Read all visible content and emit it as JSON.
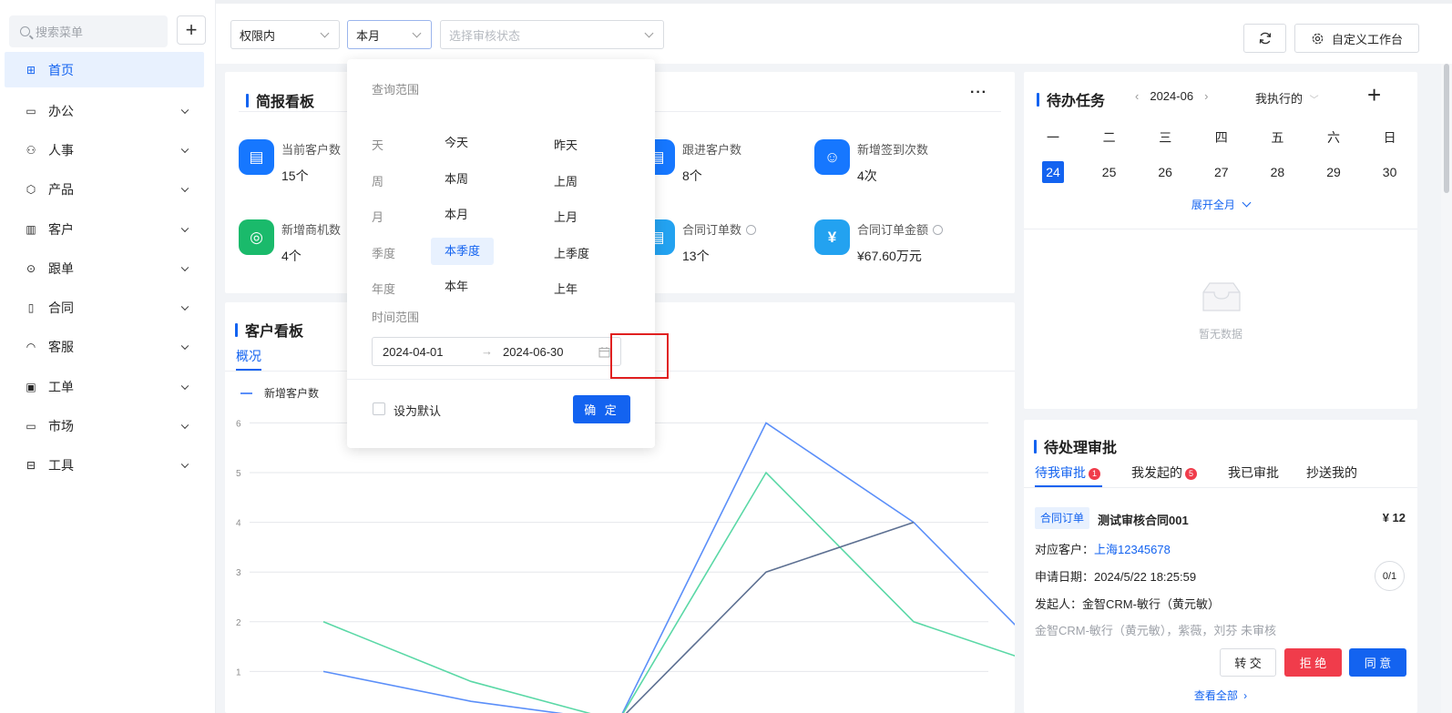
{
  "sidebar": {
    "search_placeholder": "搜索菜单",
    "add_label": "+",
    "items": [
      {
        "label": "首页",
        "icon": "home-icon",
        "glyph": "⊞"
      },
      {
        "label": "办公",
        "icon": "office-icon",
        "glyph": "▭"
      },
      {
        "label": "人事",
        "icon": "hr-icon",
        "glyph": "⚇"
      },
      {
        "label": "产品",
        "icon": "product-icon",
        "glyph": "⬡"
      },
      {
        "label": "客户",
        "icon": "customer-icon",
        "glyph": "▥"
      },
      {
        "label": "跟单",
        "icon": "followup-icon",
        "glyph": "⊙"
      },
      {
        "label": "合同",
        "icon": "contract-icon",
        "glyph": "▯"
      },
      {
        "label": "客服",
        "icon": "service-icon",
        "glyph": "◠"
      },
      {
        "label": "工单",
        "icon": "ticket-icon",
        "glyph": "▣"
      },
      {
        "label": "市场",
        "icon": "market-icon",
        "glyph": "▭"
      },
      {
        "label": "工具",
        "icon": "tools-icon",
        "glyph": "⊟"
      }
    ]
  },
  "toolbar": {
    "scope": "权限内",
    "period": "本月",
    "status_placeholder": "选择审核状态",
    "customize_label": "自定义工作台"
  },
  "brief": {
    "title": "简报看板",
    "more": "···",
    "stats": [
      {
        "label": "当前客户数",
        "value": "15个",
        "color": "#1677ff",
        "icon": "customer-count-icon",
        "glyph": "▤"
      },
      {
        "label": "跟进客户数",
        "value": "8个",
        "color": "#1677ff",
        "icon": "followup-count-icon",
        "glyph": "▤"
      },
      {
        "label": "新增签到次数",
        "value": "4次",
        "color": "#1677ff",
        "icon": "checkin-icon",
        "glyph": "☺"
      },
      {
        "label": "新增商机数",
        "value": "4个",
        "color": "#1aba6b",
        "icon": "opportunity-icon",
        "glyph": "◎"
      },
      {
        "label": "合同订单数",
        "value": "13个",
        "color": "#23a2f0",
        "icon": "order-count-icon",
        "glyph": "▤"
      },
      {
        "label": "合同订单金额",
        "value": "¥67.60万元",
        "color": "#23a2f0",
        "icon": "order-amount-icon",
        "glyph": "¥"
      }
    ]
  },
  "popup": {
    "query_label": "查询范围",
    "rows": [
      {
        "label": "天",
        "opt1": "今天",
        "opt2": "昨天",
        "selected": false
      },
      {
        "label": "周",
        "opt1": "本周",
        "opt2": "上周",
        "selected": false
      },
      {
        "label": "月",
        "opt1": "本月",
        "opt2": "上月",
        "selected": false
      },
      {
        "label": "季度",
        "opt1": "本季度",
        "opt2": "上季度",
        "selected": true
      },
      {
        "label": "年度",
        "opt1": "本年",
        "opt2": "上年",
        "selected": false
      }
    ],
    "time_range_label": "时间范围",
    "start_date": "2024-04-01",
    "arrow": "→",
    "end_date": "2024-06-30",
    "default_label": "设为默认",
    "confirm_label": "确 定"
  },
  "customer": {
    "title": "客户看板",
    "tab": "概况",
    "legend": "新增客户数"
  },
  "chart_data": {
    "type": "line",
    "title": "",
    "xlabel": "",
    "ylabel": "",
    "ylim": [
      0,
      6
    ],
    "yticks": [
      "1",
      "2",
      "3",
      "4",
      "5",
      "6"
    ],
    "x": [
      0,
      1,
      2,
      3,
      4,
      5
    ],
    "series": [
      {
        "name": "新增客户数",
        "color": "#5b8ff9",
        "values": [
          1,
          0.4,
          0,
          6,
          4,
          1
        ]
      },
      {
        "color": "#5ad8a6",
        "values": [
          2,
          0.8,
          0,
          5,
          2,
          1
        ]
      },
      {
        "color": "#5d7092",
        "values": [
          null,
          null,
          0,
          3,
          4,
          null
        ]
      }
    ],
    "grid": true,
    "legend": "top-left"
  },
  "todo": {
    "title": "待办任务",
    "month": "2024-06",
    "filter": "我执行的",
    "add": "+",
    "weekdays": [
      "一",
      "二",
      "三",
      "四",
      "五",
      "六",
      "日"
    ],
    "days": [
      "24",
      "25",
      "26",
      "27",
      "28",
      "29",
      "30"
    ],
    "today_index": 0,
    "expand_label": "展开全月",
    "empty_label": "暂无数据"
  },
  "approval": {
    "title": "待处理审批",
    "tabs": [
      {
        "label": "待我审批",
        "badge": "1"
      },
      {
        "label": "我发起的",
        "badge": "5"
      },
      {
        "label": "我已审批",
        "badge": ""
      },
      {
        "label": "抄送我的",
        "badge": ""
      }
    ],
    "item": {
      "tag": "合同订单",
      "name": "测试审核合同001",
      "amount": "¥ 12",
      "customer_label": "对应客户：",
      "customer": "上海12345678",
      "date_label": "申请日期：",
      "date": "2024/5/22 18:25:59",
      "progress": "0/1",
      "initiator_label": "发起人：",
      "initiator": "金智CRM-敏行（黄元敏）",
      "reviewers": "金智CRM-敏行（黄元敏），紫薇，刘芬 未审核"
    },
    "transfer_label": "转 交",
    "reject_label": "拒 绝",
    "approve_label": "同 意",
    "view_all_label": "查看全部"
  },
  "colors": {
    "accent": "#1363f0",
    "danger": "#f03c4b"
  }
}
